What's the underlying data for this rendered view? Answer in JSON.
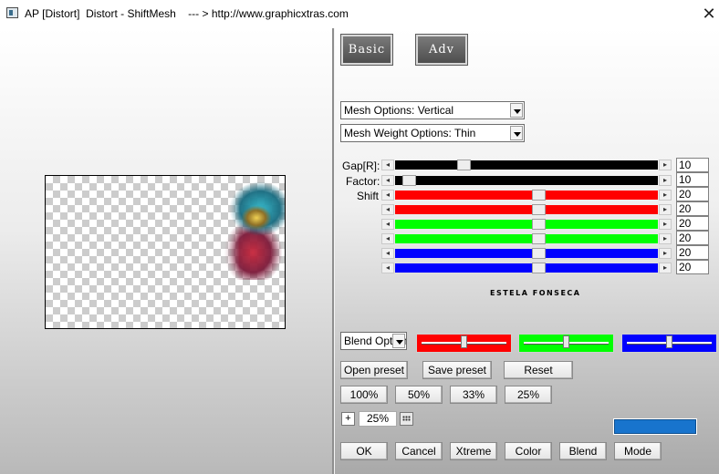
{
  "window": {
    "title": "AP [Distort]  Distort - ShiftMesh    --- > http://www.graphicxtras.com",
    "close_glyph": "✕"
  },
  "tabs": {
    "basic": "Basic",
    "adv": "Adv"
  },
  "mesh_options": "Mesh Options: Vertical",
  "mesh_weight_options": "Mesh Weight Options: Thin",
  "sliders": {
    "gap_label": "Gap[R]:",
    "factor_label": "Factor:",
    "shift_label": "Shift",
    "arrow_left": "◂",
    "arrow_right": "▸",
    "gap": {
      "value": "10",
      "level": 0.25,
      "color": "#000000"
    },
    "factor": {
      "value": "10",
      "level": 0.03,
      "color": "#000000"
    },
    "shift": [
      {
        "value": "20",
        "level": 0.55,
        "color": "#ff0000"
      },
      {
        "value": "20",
        "level": 0.55,
        "color": "#ff0000"
      },
      {
        "value": "20",
        "level": 0.55,
        "color": "#00ff00"
      },
      {
        "value": "20",
        "level": 0.55,
        "color": "#00ff00"
      },
      {
        "value": "20",
        "level": 0.55,
        "color": "#0000ff"
      },
      {
        "value": "20",
        "level": 0.55,
        "color": "#0000ff"
      }
    ]
  },
  "credit": "ESTELA FONSECA",
  "blend": {
    "options_label": "Blend Options",
    "red": {
      "color": "#ff0000",
      "level": 0.5
    },
    "green": {
      "color": "#00ff00",
      "level": 0.5
    },
    "blue": {
      "color": "#0000ff",
      "level": 0.5
    }
  },
  "presets": {
    "open": "Open preset",
    "save": "Save preset",
    "reset": "Reset"
  },
  "zoom_buttons": [
    "100%",
    "50%",
    "33%",
    "25%"
  ],
  "zoom": {
    "plus": "+",
    "value": "25%"
  },
  "accent_color": "#1874cd",
  "bottom_buttons": {
    "ok": "OK",
    "cancel": "Cancel",
    "xtreme": "Xtreme",
    "color": "Color",
    "blend": "Blend",
    "mode": "Mode"
  }
}
